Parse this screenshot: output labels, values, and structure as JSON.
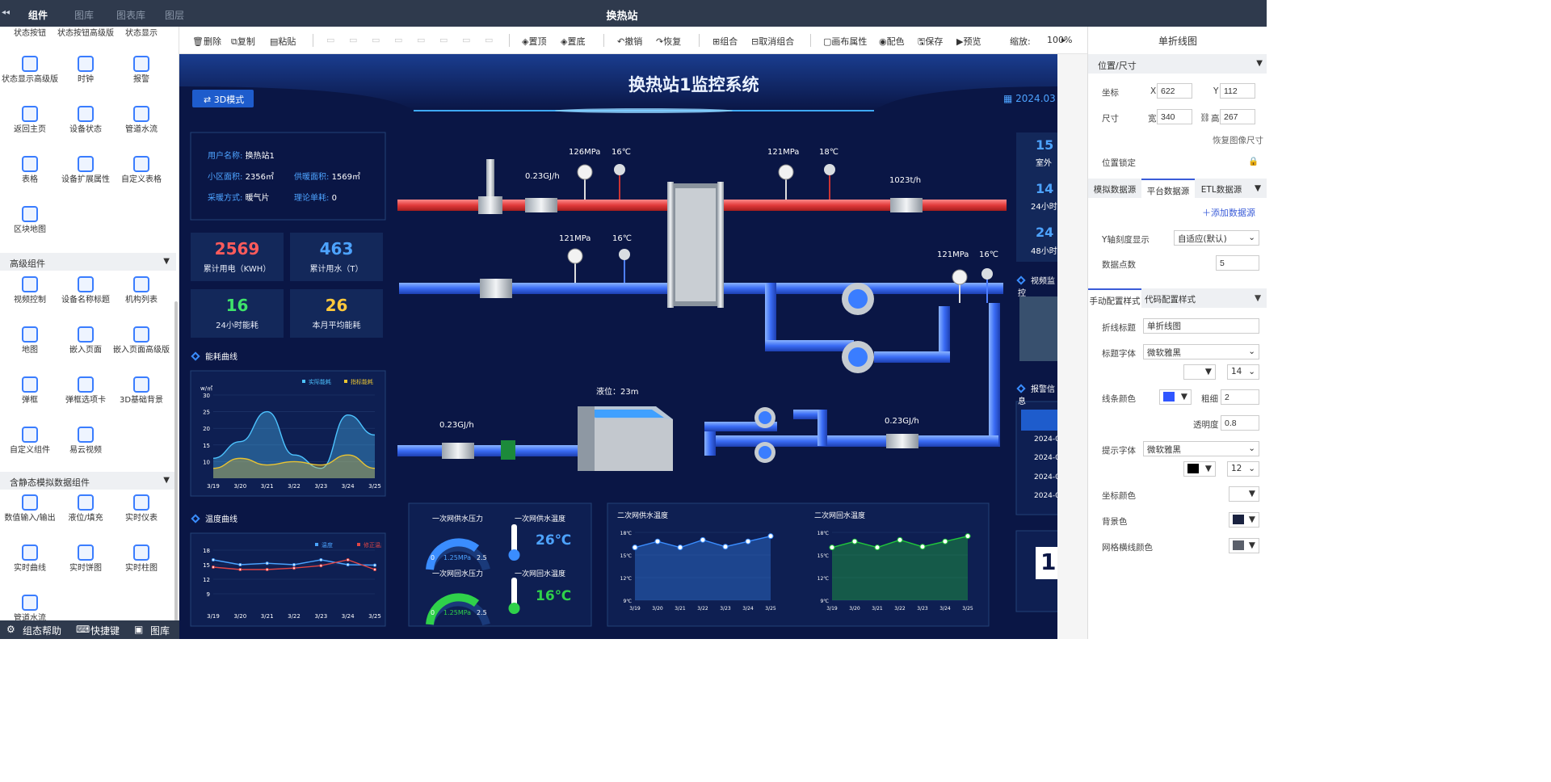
{
  "app": {
    "title": "换热站",
    "tabs": [
      "组件",
      "图库",
      "图表库",
      "图层"
    ]
  },
  "left": {
    "top_partial": [
      "状态按钮",
      "状态按钮高级版",
      "状态显示"
    ],
    "basic": [
      {
        "label": "状态显示高级版",
        "icon": "layers-icon"
      },
      {
        "label": "时钟",
        "icon": "clock-icon"
      },
      {
        "label": "报警",
        "icon": "bell-icon"
      },
      {
        "label": "返回主页",
        "icon": "home-icon"
      },
      {
        "label": "设备状态",
        "icon": "device-check-icon"
      },
      {
        "label": "管道水流",
        "icon": "pipe-flow-icon"
      },
      {
        "label": "表格",
        "icon": "table-icon"
      },
      {
        "label": "设备扩展属性",
        "icon": "device-ext-icon"
      },
      {
        "label": "自定义表格",
        "icon": "custom-table-icon"
      },
      {
        "label": "区块地图",
        "icon": "block-map-icon"
      }
    ],
    "section_advanced": "高级组件",
    "advanced": [
      {
        "label": "视频控制",
        "icon": "video-control-icon"
      },
      {
        "label": "设备名称标题",
        "icon": "title-a-icon"
      },
      {
        "label": "机构列表",
        "icon": "org-tree-icon"
      },
      {
        "label": "地图",
        "icon": "map-pin-icon"
      },
      {
        "label": "嵌入页面",
        "icon": "embed-icon"
      },
      {
        "label": "嵌入页面高级版",
        "icon": "embed-adv-icon"
      },
      {
        "label": "弹框",
        "icon": "dialog-icon"
      },
      {
        "label": "弹框选项卡",
        "icon": "dialog-tab-icon"
      },
      {
        "label": "3D基础背景",
        "icon": "cube-icon"
      },
      {
        "label": "自定义组件",
        "icon": "custom-cube-icon"
      },
      {
        "label": "易云视频",
        "icon": "video-pen-icon"
      }
    ],
    "section_static": "含静态模拟数据组件",
    "static": [
      {
        "label": "数值输入/输出",
        "icon": "number-io-icon"
      },
      {
        "label": "液位/填充",
        "icon": "liquid-icon"
      },
      {
        "label": "实时仪表",
        "icon": "gauge-icon"
      },
      {
        "label": "实时曲线",
        "icon": "line-chart-icon"
      },
      {
        "label": "实时饼图",
        "icon": "pie-chart-icon"
      },
      {
        "label": "实时柱图",
        "icon": "bar-chart-icon"
      },
      {
        "label": "管道水流",
        "icon": "pipe-flow-icon"
      }
    ],
    "bottom": [
      "组态帮助",
      "快捷键",
      "图库"
    ]
  },
  "toolbar": {
    "items": [
      "删除",
      "复制",
      "粘贴",
      "置顶",
      "置底",
      "撤销",
      "恢复",
      "组合",
      "取消组合",
      "画布属性",
      "配色",
      "保存",
      "预览"
    ],
    "zoom_label": "缩放:",
    "zoom": "100%"
  },
  "canvas": {
    "title": "换热站1监控系统",
    "mode_btn": "3D模式",
    "date": "2024.03",
    "info": {
      "user_label": "用户名称:",
      "user": "换热站1",
      "area_label": "小区面积:",
      "area": "2356㎡",
      "supply_label": "供暖面积:",
      "supply": "1569㎡",
      "method_label": "采暖方式:",
      "method": "暖气片",
      "unit_label": "理论单耗:",
      "unit": "0"
    },
    "kpis": [
      {
        "value": "2569",
        "label": "累计用电（KWH）",
        "color": "#ff5b5b"
      },
      {
        "value": "463",
        "label": "累计用水（T）",
        "color": "#4da3ff"
      },
      {
        "value": "16",
        "label": "24小时能耗",
        "color": "#3fe36a"
      },
      {
        "value": "26",
        "label": "本月平均能耗",
        "color": "#ffc93c"
      }
    ],
    "energy_title": "能耗曲线",
    "temp_title": "温度曲线",
    "pipe_labels": {
      "flow1": "0.23GJ/h",
      "p1": "126MPa",
      "t1": "16℃",
      "p2": "121MPa",
      "t2": "18℃",
      "flow2": "1023t/h",
      "p3": "121MPa",
      "t3": "16℃",
      "p4": "121MPa",
      "t4": "16℃",
      "level": "液位：23m",
      "flow3": "0.23GJ/h",
      "flow4": "0.23GJ/h"
    },
    "gauges": {
      "supply_p_title": "一次网供水压力",
      "supply_t_title": "一次网供水温度",
      "return_p_title": "一次网回水压力",
      "return_t_title": "一次网回水温度",
      "p_value": "1.25MPa",
      "p_min": "0",
      "p_max": "2.5",
      "supply_t": "26℃",
      "return_t": "16℃"
    },
    "right_stub": {
      "v1": "15",
      "l1": "室外",
      "v2": "14",
      "l2": "24小时",
      "v3": "24",
      "l3": "48小时",
      "video": "视频监控",
      "alarm": "报警信息",
      "dates": [
        "2024-0",
        "2024-0",
        "2024-0",
        "2024-0"
      ],
      "big": "1"
    }
  },
  "chart_data": [
    {
      "type": "area",
      "title": "能耗曲线",
      "ylabel": "w/㎡",
      "x": [
        "3/19",
        "3/20",
        "3/21",
        "3/22",
        "3/23",
        "3/24",
        "3/25"
      ],
      "ylim": [
        5,
        30
      ],
      "yticks": [
        10,
        15,
        20,
        25,
        30
      ],
      "series": [
        {
          "name": "实际能耗",
          "color": "#4dc3ff",
          "values": [
            11,
            16,
            25,
            12,
            8,
            24,
            18
          ]
        },
        {
          "name": "指标能耗",
          "color": "#e9c432",
          "values": [
            8,
            11,
            9,
            10,
            9,
            12,
            8
          ]
        }
      ]
    },
    {
      "type": "line",
      "title": "温度曲线",
      "x": [
        "3/19",
        "3/20",
        "3/21",
        "3/22",
        "3/23",
        "3/24",
        "3/25"
      ],
      "ylim": [
        6,
        18
      ],
      "yticks": [
        9,
        12,
        15,
        18
      ],
      "series": [
        {
          "name": "温度",
          "color": "#4aa3ff",
          "values": [
            16,
            15,
            15.3,
            15,
            16,
            15,
            14.9
          ]
        },
        {
          "name": "修正温度",
          "color": "#e04545",
          "values": [
            14.5,
            14,
            14,
            14.3,
            14.8,
            16,
            14
          ]
        }
      ]
    },
    {
      "type": "area",
      "title": "二次网供水温度",
      "x": [
        "3/19",
        "3/20",
        "3/21",
        "3/22",
        "3/23",
        "3/24",
        "3/25"
      ],
      "ylim": [
        9,
        18
      ],
      "yticks": [
        9,
        12,
        15,
        18
      ],
      "ytick_labels": [
        "9℃",
        "12℃",
        "15℃",
        "18℃"
      ],
      "series": [
        {
          "color": "#3a8dff",
          "values": [
            16,
            16.8,
            16,
            17,
            16.1,
            16.8,
            17.5
          ]
        }
      ]
    },
    {
      "type": "area",
      "title": "二次网回水温度",
      "x": [
        "3/19",
        "3/20",
        "3/21",
        "3/22",
        "3/23",
        "3/24",
        "3/25"
      ],
      "ylim": [
        9,
        18
      ],
      "yticks": [
        9,
        12,
        15,
        18
      ],
      "ytick_labels": [
        "9℃",
        "12℃",
        "15℃",
        "18℃"
      ],
      "series": [
        {
          "color": "#21c93a",
          "values": [
            16,
            16.8,
            16,
            17,
            16.1,
            16.8,
            17.5
          ]
        }
      ]
    }
  ],
  "right": {
    "title": "单折线图",
    "pos_section": "位置/尺寸",
    "coord_label": "坐标",
    "x_label": "X",
    "x": "622",
    "y_label": "Y",
    "y": "112",
    "size_label": "尺寸",
    "w_label": "宽",
    "w": "340",
    "h_label": "高",
    "h": "267",
    "restore": "恢复图像尺寸",
    "lock": "位置锁定",
    "ds_tabs": [
      "模拟数据源",
      "平台数据源",
      "ETL数据源"
    ],
    "add_ds": "添加数据源",
    "yaxis_label": "Y轴刻度显示",
    "yaxis": "自适应(默认)",
    "points_label": "数据点数",
    "points": "5",
    "style_tabs": [
      "手动配置样式",
      "代码配置样式"
    ],
    "line_title_label": "折线标题",
    "line_title": "单折线图",
    "title_font_label": "标题字体",
    "title_font": "微软雅黑",
    "title_size": "14",
    "line_color_label": "线条颜色",
    "line_color": "#2f55ff",
    "thick_label": "粗细",
    "thick": "2",
    "opacity_label": "透明度",
    "opacity": "0.8",
    "tip_font_label": "提示字体",
    "tip_font": "微软雅黑",
    "tip_size": "12",
    "tip_color": "#000000",
    "axis_color_label": "坐标颜色",
    "bg_color_label": "背景色",
    "bg_color": "#1a2240",
    "grid_color_label": "网格横线颜色",
    "grid_color": "#5a5f6a"
  }
}
